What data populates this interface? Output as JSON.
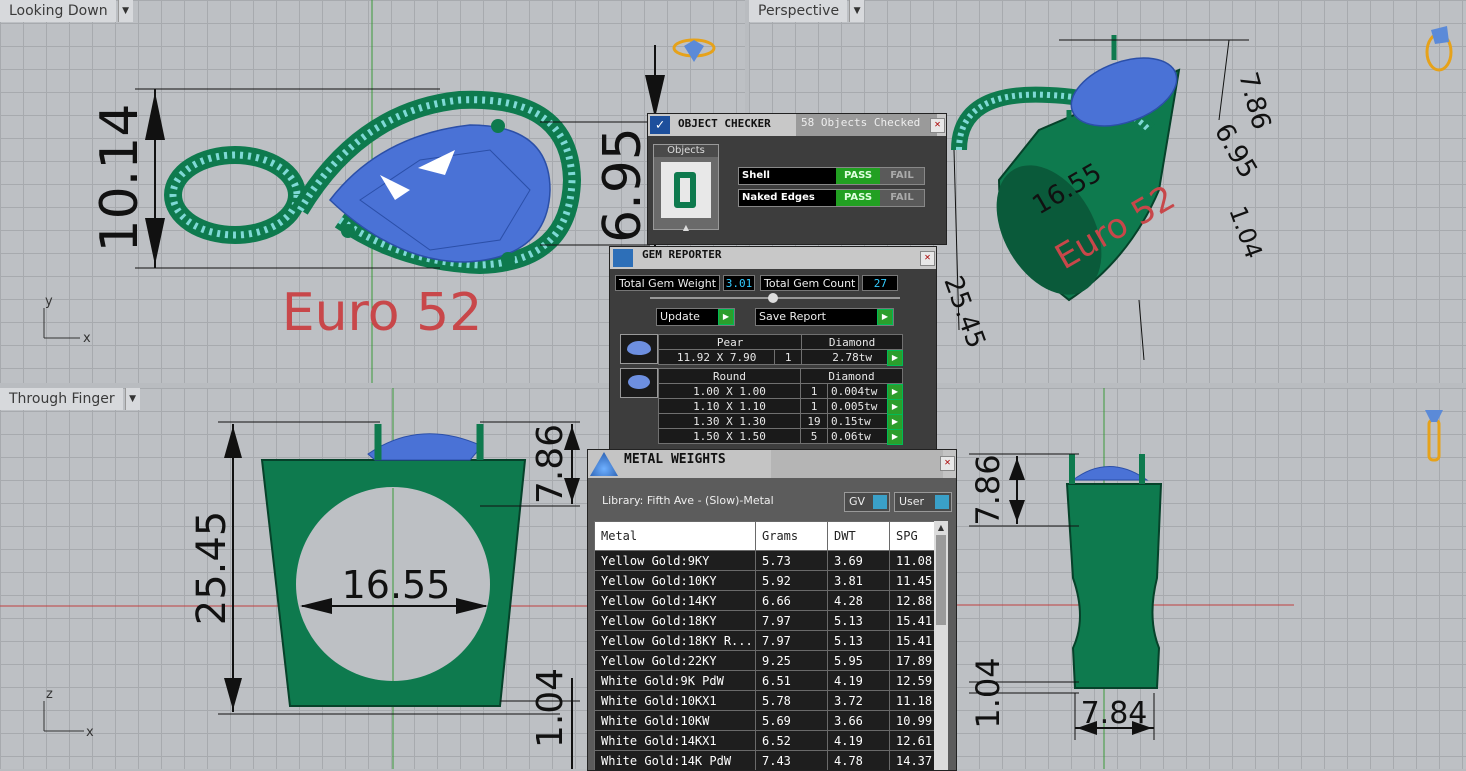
{
  "viewports": {
    "top": {
      "title": "Looking Down",
      "axis1": "y",
      "axis2": "x",
      "dim_height": "10.14",
      "dim_small": "6.95",
      "label": "Euro 52"
    },
    "perspective": {
      "title": "Perspective",
      "dim1": "7.86",
      "dim2": "6.95",
      "dim3": "16.55",
      "dim4": "1.04",
      "dim5": "25.45",
      "label": "Euro 52"
    },
    "front": {
      "title": "Through Finger",
      "axis1": "z",
      "axis2": "x",
      "dim_height": "25.45",
      "dim_width": "16.55",
      "dim_head": "7.86",
      "dim_band": "1.04"
    },
    "side": {
      "dim_head": "7.86",
      "dim_band": "1.04",
      "dim_width": "7.84"
    }
  },
  "object_checker": {
    "title": "OBJECT CHECKER",
    "tab2": "58  Objects Checked",
    "objects_label": "Objects",
    "rows": [
      {
        "name": "Shell",
        "pass": "PASS",
        "fail": "FAIL"
      },
      {
        "name": "Naked Edges",
        "pass": "PASS",
        "fail": "FAIL"
      }
    ]
  },
  "gem_reporter": {
    "title": "GEM REPORTER",
    "total_weight_label": "Total Gem Weight",
    "total_weight": "3.01",
    "total_count_label": "Total Gem Count",
    "total_count": "27",
    "update_label": "Update",
    "save_label": "Save Report",
    "groups": [
      {
        "shape": "Pear",
        "material": "Diamond",
        "rows": [
          {
            "size": "11.92 X 7.90",
            "qty": "1",
            "weight": "2.78tw"
          }
        ]
      },
      {
        "shape": "Round",
        "material": "Diamond",
        "rows": [
          {
            "size": "1.00 X 1.00",
            "qty": "1",
            "weight": "0.004tw"
          },
          {
            "size": "1.10 X 1.10",
            "qty": "1",
            "weight": "0.005tw"
          },
          {
            "size": "1.30 X 1.30",
            "qty": "19",
            "weight": "0.15tw"
          },
          {
            "size": "1.50 X 1.50",
            "qty": "5",
            "weight": "0.06tw"
          }
        ]
      }
    ]
  },
  "metal_weights": {
    "title": "METAL WEIGHTS",
    "library": "Library: Fifth Ave - (Slow)-Metal",
    "gv_label": "GV",
    "user_label": "User",
    "columns": [
      "Metal",
      "Grams",
      "DWT",
      "SPG"
    ],
    "rows": [
      [
        "Yellow Gold:9KY",
        "5.73",
        "3.69",
        "11.08"
      ],
      [
        "Yellow Gold:10KY",
        "5.92",
        "3.81",
        "11.45"
      ],
      [
        "Yellow Gold:14KY",
        "6.66",
        "4.28",
        "12.88"
      ],
      [
        "Yellow Gold:18KY",
        "7.97",
        "5.13",
        "15.41"
      ],
      [
        "Yellow Gold:18KY R...",
        "7.97",
        "5.13",
        "15.41"
      ],
      [
        "Yellow Gold:22KY",
        "9.25",
        "5.95",
        "17.89"
      ],
      [
        "White Gold:9K PdW",
        "6.51",
        "4.19",
        "12.59"
      ],
      [
        "White Gold:10KX1",
        "5.78",
        "3.72",
        "11.18"
      ],
      [
        "White Gold:10KW",
        "5.69",
        "3.66",
        "10.99"
      ],
      [
        "White Gold:14KX1",
        "6.52",
        "4.19",
        "12.61"
      ],
      [
        "White Gold:14K PdW",
        "7.43",
        "4.78",
        "14.37"
      ]
    ]
  },
  "colors": {
    "ring": "#0e7a4e",
    "gem": "#4a72d6",
    "euro_label": "#c8474a",
    "dim": "#111111"
  }
}
